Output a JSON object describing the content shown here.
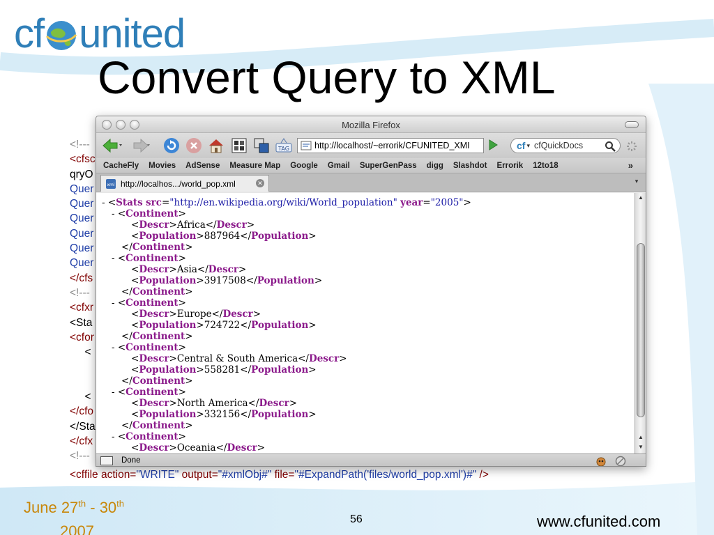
{
  "slide": {
    "logo_left": "cf",
    "logo_right": "united",
    "title": "Convert Query to XML",
    "page_number": "56",
    "website": "www.cfunited.com",
    "date_start": "June 27",
    "date_start_sup": "th",
    "date_sep": " - 30",
    "date_end_sup": "th",
    "date_year": "2007",
    "colors": {
      "logo": "#2f7fb8",
      "date": "#c8870a",
      "code_tag": "#800000",
      "code_value": "#1f3ea8"
    }
  },
  "code_lines": [
    {
      "text": "<!---",
      "cls": "c-gray"
    },
    {
      "text": "<cfsc",
      "cls": "c-maroon"
    },
    {
      "text": "qryO",
      "cls": "c-black"
    },
    {
      "text": "Quer",
      "cls": "c-blue"
    },
    {
      "text": "Quer",
      "cls": "c-blue"
    },
    {
      "text": "Quer",
      "cls": "c-blue"
    },
    {
      "text": "Quer",
      "cls": "c-blue"
    },
    {
      "text": "Quer",
      "cls": "c-blue"
    },
    {
      "text": "Quer",
      "cls": "c-blue"
    },
    {
      "text": "</cfs",
      "cls": "c-maroon"
    },
    {
      "text": "<!---",
      "cls": "c-gray"
    },
    {
      "text": "<cfxr",
      "cls": "c-maroon"
    },
    {
      "text": "<Sta",
      "cls": "c-black"
    },
    {
      "text": "<cfor",
      "cls": "c-maroon"
    },
    {
      "text": "     <",
      "cls": "c-black"
    },
    {
      "text": "",
      "cls": "c-black"
    },
    {
      "text": "",
      "cls": "c-black"
    },
    {
      "text": "     <",
      "cls": "c-black"
    },
    {
      "text": "</cfo",
      "cls": "c-maroon"
    },
    {
      "text": "</Sta",
      "cls": "c-black"
    },
    {
      "text": "</cfx",
      "cls": "c-maroon"
    },
    {
      "text": "<!---",
      "cls": "c-gray"
    }
  ],
  "bottom_code": {
    "p1": "<cffile action=",
    "v1": "\"WRITE\"",
    "p2": " output=",
    "v2": "\"#xmlObj#\"",
    "p3": " file=",
    "v3": "\"#ExpandPath('files/world_pop.xml')#\"",
    "p4": " />"
  },
  "browser": {
    "window_title": "Mozilla Firefox",
    "url": "http://localhost/~errorik/CFUNITED_XMI",
    "search_engine_label": "cf",
    "search_placeholder": "cfQuickDocs",
    "bookmarks": [
      "CacheFly",
      "Movies",
      "AdSense",
      "Measure Map",
      "Google",
      "Gmail",
      "SuperGenPass",
      "digg",
      "Slashdot",
      "Errorik",
      "12to18"
    ],
    "bookmarks_more": "»",
    "tab_title": "http://localhos.../world_pop.xml",
    "status": "Done",
    "icons": [
      "back-arrow-icon",
      "forward-arrow-icon",
      "reload-icon",
      "stop-icon",
      "home-icon",
      "tag-icon",
      "go-arrow-icon",
      "search-magnifier-icon"
    ]
  },
  "xml_lines": [
    {
      "indent": 0,
      "minus": "- ",
      "open": "<",
      "tag": "Stats",
      "attrs": [
        {
          "name": "src",
          "value": "\"http://en.wikipedia.org/wiki/World_population\""
        },
        {
          "name": "year",
          "value": "\"2005\""
        }
      ],
      "close": ">"
    },
    {
      "indent": 1,
      "minus": "- ",
      "text": "<",
      "tag": "Continent",
      "close": ">"
    },
    {
      "indent": 3,
      "minus": "",
      "text": "<",
      "tag": "Descr",
      "close": ">",
      "value": "Africa",
      "endtag": "Descr"
    },
    {
      "indent": 3,
      "minus": "",
      "text": "<",
      "tag": "Population",
      "close": ">",
      "value": "887964",
      "endtag": "Population"
    },
    {
      "indent": 2,
      "minus": "",
      "text": "</",
      "tag": "Continent",
      "close": ">"
    },
    {
      "indent": 1,
      "minus": "- ",
      "text": "<",
      "tag": "Continent",
      "close": ">"
    },
    {
      "indent": 3,
      "minus": "",
      "text": "<",
      "tag": "Descr",
      "close": ">",
      "value": "Asia",
      "endtag": "Descr"
    },
    {
      "indent": 3,
      "minus": "",
      "text": "<",
      "tag": "Population",
      "close": ">",
      "value": "3917508",
      "endtag": "Population"
    },
    {
      "indent": 2,
      "minus": "",
      "text": "</",
      "tag": "Continent",
      "close": ">"
    },
    {
      "indent": 1,
      "minus": "- ",
      "text": "<",
      "tag": "Continent",
      "close": ">"
    },
    {
      "indent": 3,
      "minus": "",
      "text": "<",
      "tag": "Descr",
      "close": ">",
      "value": "Europe",
      "endtag": "Descr"
    },
    {
      "indent": 3,
      "minus": "",
      "text": "<",
      "tag": "Population",
      "close": ">",
      "value": "724722",
      "endtag": "Population"
    },
    {
      "indent": 2,
      "minus": "",
      "text": "</",
      "tag": "Continent",
      "close": ">"
    },
    {
      "indent": 1,
      "minus": "- ",
      "text": "<",
      "tag": "Continent",
      "close": ">"
    },
    {
      "indent": 3,
      "minus": "",
      "text": "<",
      "tag": "Descr",
      "close": ">",
      "value": "Central & South America",
      "endtag": "Descr"
    },
    {
      "indent": 3,
      "minus": "",
      "text": "<",
      "tag": "Population",
      "close": ">",
      "value": "558281",
      "endtag": "Population"
    },
    {
      "indent": 2,
      "minus": "",
      "text": "</",
      "tag": "Continent",
      "close": ">"
    },
    {
      "indent": 1,
      "minus": "- ",
      "text": "<",
      "tag": "Continent",
      "close": ">"
    },
    {
      "indent": 3,
      "minus": "",
      "text": "<",
      "tag": "Descr",
      "close": ">",
      "value": "North America",
      "endtag": "Descr"
    },
    {
      "indent": 3,
      "minus": "",
      "text": "<",
      "tag": "Population",
      "close": ">",
      "value": "332156",
      "endtag": "Population"
    },
    {
      "indent": 2,
      "minus": "",
      "text": "</",
      "tag": "Continent",
      "close": ">"
    },
    {
      "indent": 1,
      "minus": "- ",
      "text": "<",
      "tag": "Continent",
      "close": ">"
    },
    {
      "indent": 3,
      "minus": "",
      "text": "<",
      "tag": "Descr",
      "close": ">",
      "value": "Oceania",
      "endtag": "Descr"
    }
  ]
}
